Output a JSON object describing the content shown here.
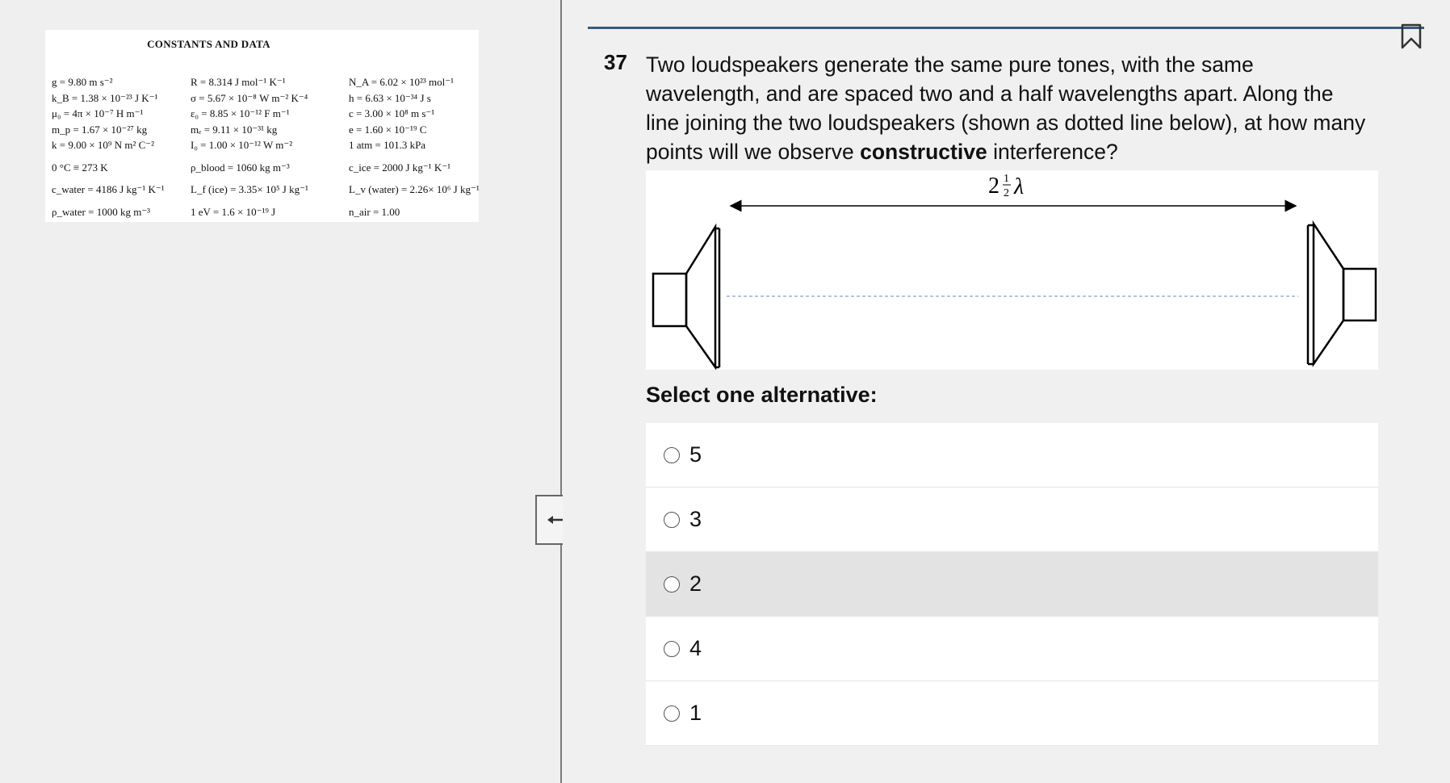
{
  "constants": {
    "title": "CONSTANTS AND DATA",
    "col1": [
      "g = 9.80 m s⁻²",
      "k_B = 1.38 × 10⁻²³ J K⁻¹",
      "μ₀ = 4π × 10⁻⁷ H m⁻¹",
      "m_p = 1.67 × 10⁻²⁷ kg",
      "k = 9.00 × 10⁹ N m² C⁻²",
      "0 °C ≡ 273 K",
      "c_water = 4186 J kg⁻¹ K⁻¹",
      "ρ_water = 1000 kg m⁻³"
    ],
    "col2": [
      "R = 8.314 J mol⁻¹ K⁻¹",
      "σ = 5.67 × 10⁻⁸ W m⁻² K⁻⁴",
      "ε₀ = 8.85 × 10⁻¹² F m⁻¹",
      "mₑ = 9.11 × 10⁻³¹ kg",
      "I₀ = 1.00 × 10⁻¹² W m⁻²",
      "ρ_blood = 1060 kg m⁻³",
      "L_f (ice) = 3.35× 10⁵ J kg⁻¹",
      "1 eV = 1.6 × 10⁻¹⁹ J"
    ],
    "col3": [
      "N_A = 6.02 × 10²³ mol⁻¹",
      "h = 6.63 × 10⁻³⁴ J s",
      "c = 3.00 × 10⁸ m s⁻¹",
      "e = 1.60 × 10⁻¹⁹ C",
      "1 atm = 101.3 kPa",
      "c_ice = 2000 J kg⁻¹ K⁻¹",
      "L_v (water) = 2.26× 10⁶ J kg⁻¹",
      "n_air = 1.00"
    ]
  },
  "question": {
    "number": "37",
    "text_before": "Two loudspeakers generate the same pure tones, with the same wavelength, and are spaced two and a half wavelengths apart. Along the line joining the two loudspeakers (shown as dotted line below), at how many points will we observe ",
    "text_bold": "constructive",
    "text_after": " interference?",
    "figure_label_whole": "2",
    "figure_label_num": "1",
    "figure_label_den": "2",
    "figure_label_symbol": "λ"
  },
  "select_label": "Select one alternative:",
  "options": [
    "5",
    "3",
    "2",
    "4",
    "1"
  ],
  "icons": {
    "flag": "bookmark-flag-icon",
    "resize": "resize-arrows-icon"
  },
  "colors": {
    "top_rule": "#3c5a7a",
    "divider": "#7a7a7a"
  }
}
